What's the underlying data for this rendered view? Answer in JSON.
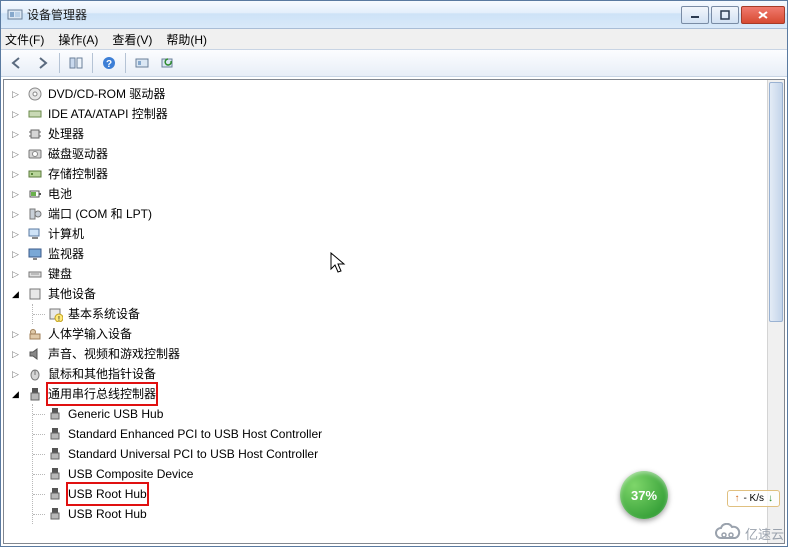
{
  "window": {
    "title": "设备管理器"
  },
  "menu": {
    "file": "文件(F)",
    "action": "操作(A)",
    "view": "查看(V)",
    "help": "帮助(H)"
  },
  "tree": {
    "dvd": "DVD/CD-ROM 驱动器",
    "ide": "IDE ATA/ATAPI 控制器",
    "cpu": "处理器",
    "disk": "磁盘驱动器",
    "storage": "存储控制器",
    "battery": "电池",
    "ports": "端口 (COM 和 LPT)",
    "computer": "计算机",
    "monitor": "监视器",
    "keyboard": "键盘",
    "other": "其他设备",
    "other_child": "基本系统设备",
    "hid": "人体学输入设备",
    "sound": "声音、视频和游戏控制器",
    "mouse": "鼠标和其他指针设备",
    "usb": "通用串行总线控制器",
    "usb_children": {
      "generic": "Generic USB Hub",
      "enhanced": "Standard Enhanced PCI to USB Host Controller",
      "universal": "Standard Universal PCI to USB Host Controller",
      "composite": "USB Composite Device",
      "root1": "USB Root Hub",
      "root2": "USB Root Hub"
    }
  },
  "speed": {
    "up": "- K/s",
    "down_icon": "↓"
  },
  "badge": {
    "percent": "37%"
  },
  "brand": {
    "text": "亿速云"
  }
}
